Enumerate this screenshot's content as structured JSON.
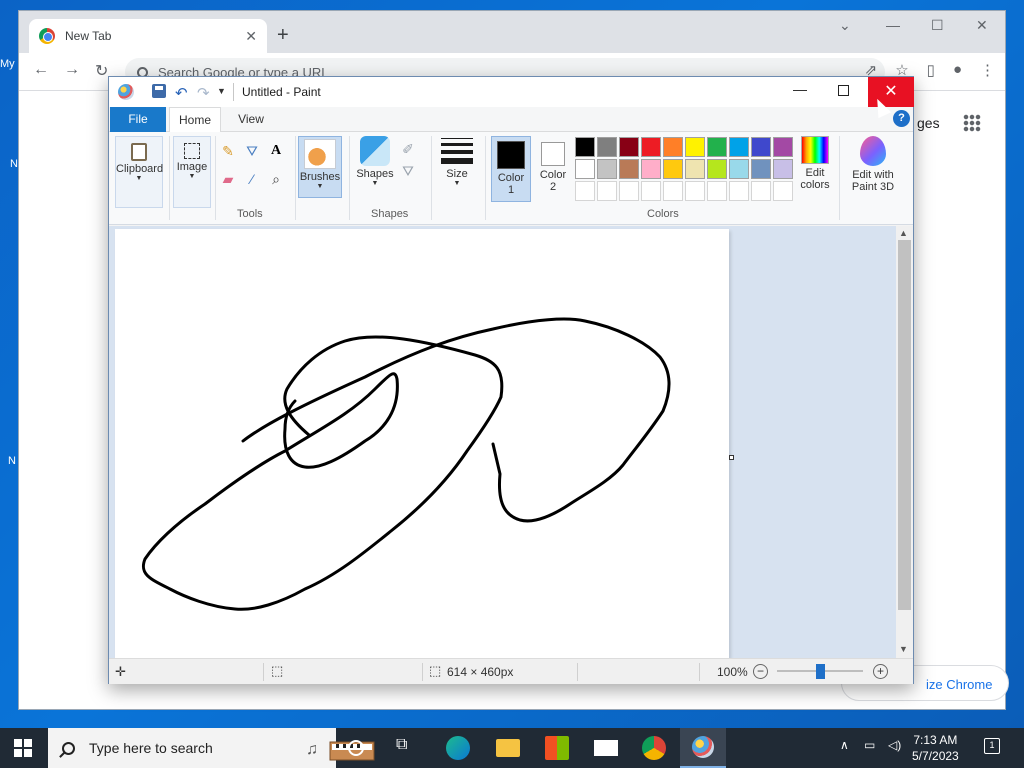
{
  "chrome": {
    "tab_title": "New Tab",
    "tab_close": "✕",
    "new_tab": "+",
    "omnibox_placeholder": "Search Google or type a URL",
    "images_link": "ges",
    "customize_label": "ize Chrome"
  },
  "paint": {
    "window_title": "Untitled - Paint",
    "tabs": {
      "file": "File",
      "home": "Home",
      "view": "View"
    },
    "help": "?",
    "groups": {
      "clipboard": "Clipboard",
      "image": "Image",
      "tools": "Tools",
      "brushes": "Brushes",
      "shapes": "Shapes",
      "size": "Size",
      "colors": "Colors"
    },
    "color1": {
      "label_line1": "Color",
      "label_line2": "1",
      "value": "#000000"
    },
    "color2": {
      "label_line1": "Color",
      "label_line2": "2",
      "value": "#ffffff"
    },
    "edit_colors": {
      "line1": "Edit",
      "line2": "colors"
    },
    "paint3d": {
      "line1": "Edit with",
      "line2": "Paint 3D"
    },
    "palette": [
      "#000000",
      "#7f7f7f",
      "#880015",
      "#ed1c24",
      "#ff7f27",
      "#fff200",
      "#22b14c",
      "#00a2e8",
      "#3f48cc",
      "#a349a4",
      "#ffffff",
      "#c3c3c3",
      "#b97a57",
      "#ffaec9",
      "#ffc90e",
      "#efe4b0",
      "#b5e61d",
      "#99d9ea",
      "#7092be",
      "#c8bfe7",
      "#ffffff",
      "#ffffff",
      "#ffffff",
      "#ffffff",
      "#ffffff",
      "#ffffff",
      "#ffffff",
      "#ffffff",
      "#ffffff",
      "#ffffff"
    ],
    "status": {
      "canvas_size": "614 × 460px",
      "zoom": "100%",
      "zoom_fraction": 0.5
    }
  },
  "taskbar": {
    "search_placeholder": "Type here to search",
    "time": "7:13 AM",
    "date": "5/7/2023",
    "notification_count": "1"
  },
  "desktop": {
    "icon_fragments": [
      "My",
      "N",
      "N"
    ]
  }
}
